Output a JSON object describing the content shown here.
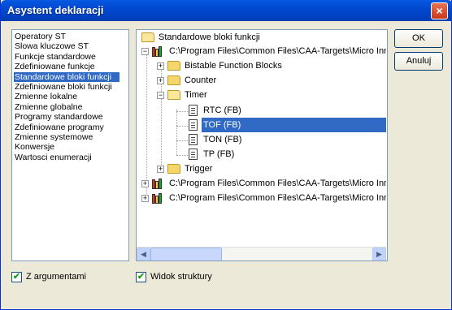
{
  "window": {
    "title": "Asystent deklaracji",
    "close_glyph": "×"
  },
  "categories": {
    "items": [
      "Operatory ST",
      "Slowa kluczowe ST",
      "Funkcje standardowe",
      "Zdefiniowane funkcje",
      "Standardowe bloki funkcji",
      "Zdefiniowane bloki funkcji",
      "Zmienne lokalne",
      "Zmienne globalne",
      "Programy standardowe",
      "Zdefiniowane programy",
      "Zmienne systemowe",
      "Konwersje",
      "Wartosci enumeracji"
    ],
    "selected": "Standardowe bloki funkcji"
  },
  "tree": {
    "root": "Standardowe bloki funkcji",
    "library_1": "C:\\Program Files\\Common Files\\CAA-Targets\\Micro Innovation",
    "folders": [
      "Bistable Function Blocks",
      "Counter",
      "Timer"
    ],
    "timer_items": [
      "RTC (FB)",
      "TOF (FB)",
      "TON (FB)",
      "TP (FB)"
    ],
    "selected_item": "TOF (FB)",
    "trigger": "Trigger",
    "library_2": "C:\\Program Files\\Common Files\\CAA-Targets\\Micro Innovation",
    "library_3": "C:\\Program Files\\Common Files\\CAA-Targets\\Micro Innovation",
    "expand_glyph": "+",
    "collapse_glyph": "−"
  },
  "scroll": {
    "left_arrow": "◀",
    "right_arrow": "▶"
  },
  "buttons": {
    "ok": "OK",
    "cancel": "Anuluj"
  },
  "options": {
    "with_arguments": {
      "label": "Z argumentami",
      "checked": true
    },
    "structure_view": {
      "label": "Widok struktury",
      "checked": true
    },
    "check_glyph": "✔"
  },
  "colors": {
    "title_bar": "#0249d0",
    "selection": "#316ac5",
    "window": "#ece9d8"
  }
}
